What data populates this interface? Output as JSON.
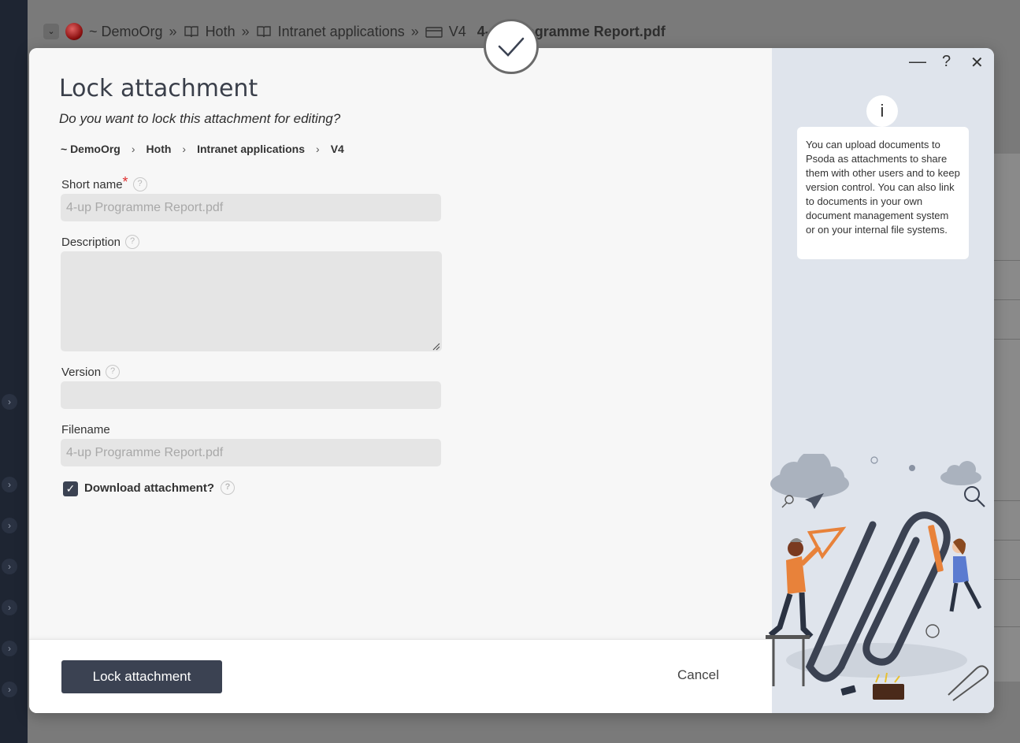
{
  "background": {
    "breadcrumb": {
      "org": "~ DemoOrg",
      "item1": "Hoth",
      "item2": "Intranet applications",
      "item3": "V4",
      "item4": "4-up Programme Report.pdf"
    }
  },
  "dialog": {
    "title": "Lock attachment",
    "subtitle": "Do you want to lock this attachment for editing?",
    "breadcrumb": [
      "~ DemoOrg",
      "Hoth",
      "Intranet applications",
      "V4"
    ],
    "fields": {
      "short_name": {
        "label": "Short name",
        "value": "4-up Programme Report.pdf"
      },
      "description": {
        "label": "Description",
        "value": ""
      },
      "version": {
        "label": "Version",
        "value": ""
      },
      "filename": {
        "label": "Filename",
        "value": "4-up Programme Report.pdf"
      }
    },
    "download_checkbox": {
      "label": "Download attachment?",
      "checked": true
    },
    "buttons": {
      "primary": "Lock attachment",
      "cancel": "Cancel"
    },
    "window_controls": {
      "minimize": "—",
      "help": "?",
      "close": "✕"
    },
    "info_text": "You can upload documents to Psoda as attachments to share them with other users and to keep version control. You can also link to documents in your own document management system or on your internal file systems."
  },
  "colors": {
    "primary": "#3b4252",
    "panel": "#dfe4ec",
    "required": "#e03030"
  }
}
